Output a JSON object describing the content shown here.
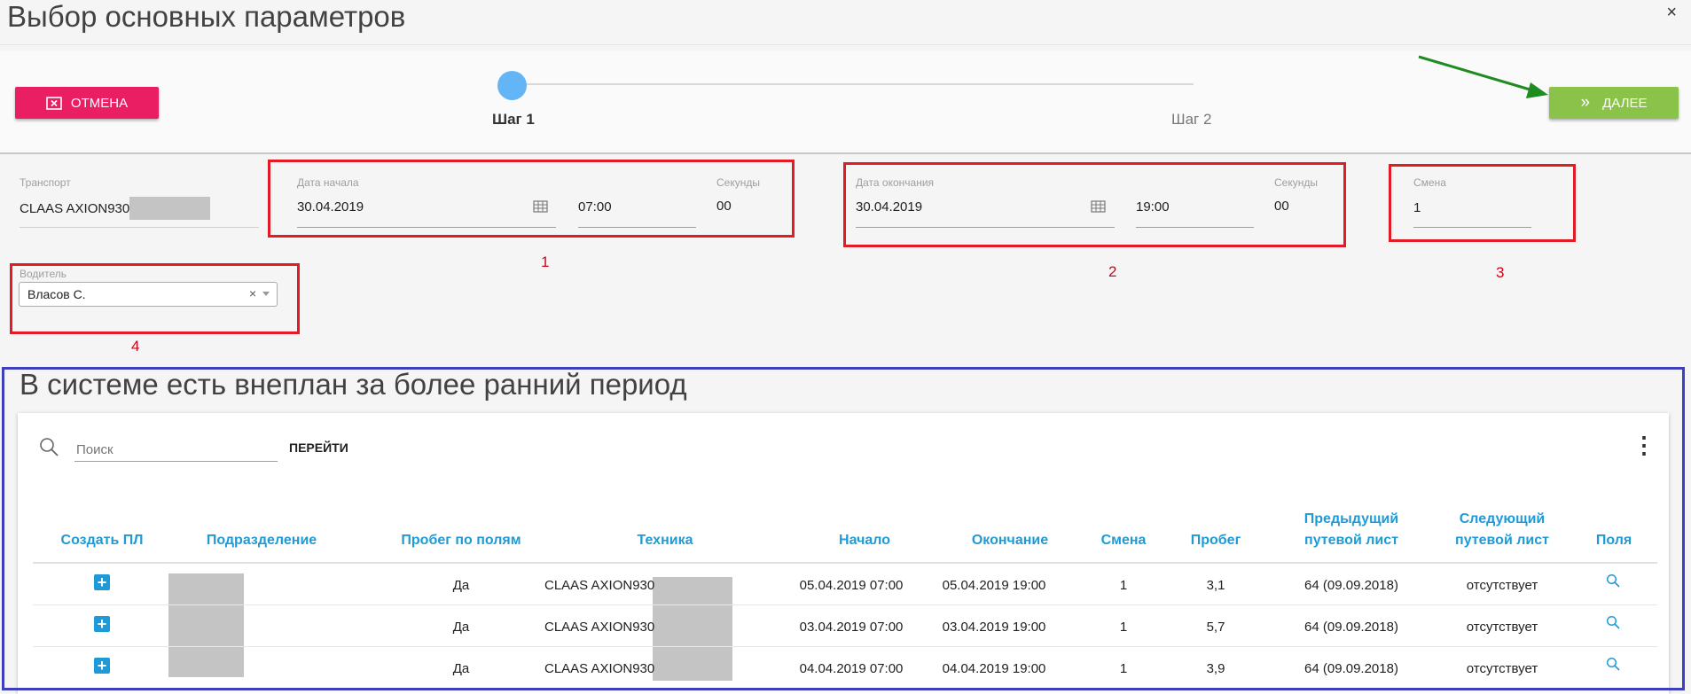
{
  "dialog": {
    "title": "Выбор основных параметров",
    "close": "×"
  },
  "toolbar": {
    "cancel_label": "ОТМЕНА",
    "next_label": "ДАЛЕЕ",
    "next_icon": "»"
  },
  "stepper": {
    "step1": "Шаг 1",
    "step2": "Шаг 2",
    "progress": 0
  },
  "form": {
    "transport": {
      "label": "Транспорт",
      "value": "CLAAS AXION930"
    },
    "start": {
      "label": "Дата начала",
      "date": "30.04.2019",
      "time": "07:00",
      "seconds_label": "Секунды",
      "seconds": "00"
    },
    "end": {
      "label": "Дата окончания",
      "date": "30.04.2019",
      "time": "19:00",
      "seconds_label": "Секунды",
      "seconds": "00"
    },
    "shift": {
      "label": "Смена",
      "value": "1"
    },
    "driver": {
      "label": "Водитель",
      "value": "Власов С.",
      "clear": "×"
    }
  },
  "annotations": {
    "n1": "1",
    "n2": "2",
    "n3": "3",
    "n4": "4"
  },
  "section": {
    "title": "В системе есть внеплан за более ранний период"
  },
  "search": {
    "placeholder": "Поиск",
    "go_label": "ПЕРЕЙТИ",
    "more_icon": "⋮"
  },
  "table": {
    "headers": {
      "create": "Создать ПЛ",
      "division": "Подразделение",
      "fields_mileage": "Пробег по полям",
      "machine": "Техника",
      "start": "Начало",
      "end": "Окончание",
      "shift": "Смена",
      "mileage": "Пробег",
      "prev_1": "Предыдущий",
      "prev_2": "путевой лист",
      "next_1": "Следующий",
      "next_2": "путевой лист",
      "fields": "Поля"
    },
    "rows": [
      {
        "fields_mileage": "Да",
        "machine": "CLAAS AXION930",
        "start": "05.04.2019 07:00",
        "end": "05.04.2019 19:00",
        "shift": "1",
        "mileage": "3,1",
        "prev": "64 (09.09.2018)",
        "next": "отсутствует"
      },
      {
        "fields_mileage": "Да",
        "machine": "CLAAS AXION930",
        "start": "03.04.2019 07:00",
        "end": "03.04.2019 19:00",
        "shift": "1",
        "mileage": "5,7",
        "prev": "64 (09.09.2018)",
        "next": "отсутствует"
      },
      {
        "fields_mileage": "Да",
        "machine": "CLAAS AXION930",
        "start": "04.04.2019 07:00",
        "end": "04.04.2019 19:00",
        "shift": "1",
        "mileage": "3,9",
        "prev": "64 (09.09.2018)",
        "next": "отсутствует"
      }
    ]
  },
  "colors": {
    "cancel": "#e91e63",
    "next": "#8bc34a",
    "accent": "#1e9bd7",
    "annotation_red": "#e21b25",
    "annotation_blue": "#3d3fbf",
    "arrow_green": "#1e8c1e"
  }
}
